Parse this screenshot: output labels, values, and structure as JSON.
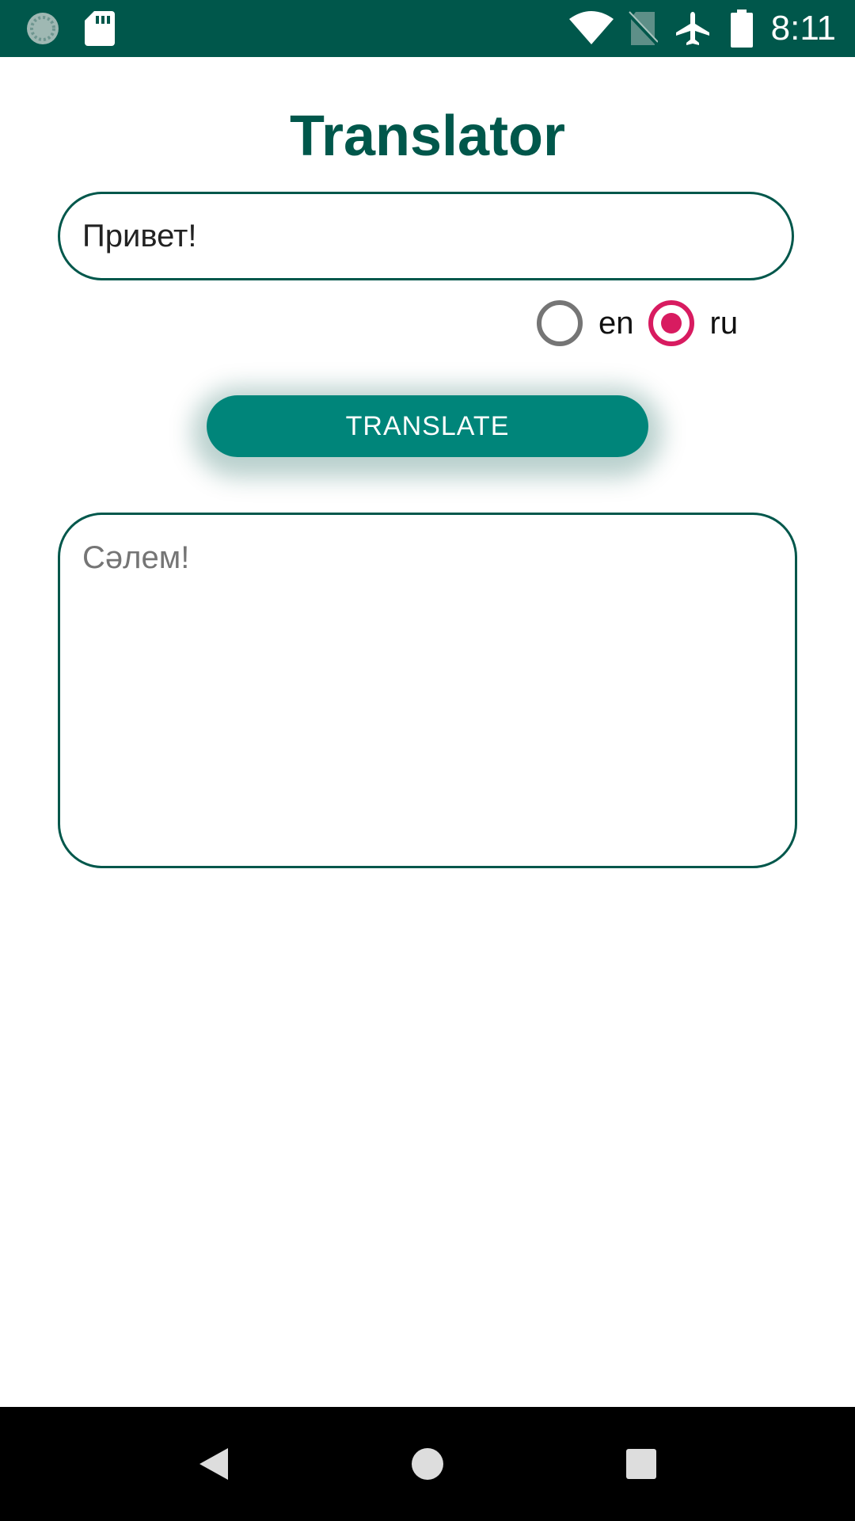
{
  "status_bar": {
    "time": "8:11",
    "icons": [
      "sync-icon",
      "sd-card-icon",
      "wifi-icon",
      "no-sim-icon",
      "airplane-mode-icon",
      "battery-icon"
    ],
    "background": "#00574b"
  },
  "app": {
    "title": "Translator",
    "accent_color": "#00574b",
    "button_color": "#00857a",
    "radio_checked_color": "#d81b60"
  },
  "input": {
    "value": "Привет!"
  },
  "language_options": [
    {
      "label": "en",
      "checked": false
    },
    {
      "label": "ru",
      "checked": true
    }
  ],
  "translate_button": {
    "label": "TRANSLATE"
  },
  "output": {
    "value": "Сәлем!"
  },
  "nav_bar": {
    "buttons": [
      "back-icon",
      "home-icon",
      "recents-icon"
    ]
  }
}
